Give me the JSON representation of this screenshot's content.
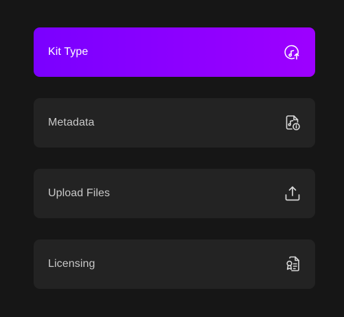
{
  "steps": [
    {
      "label": "Kit Type",
      "icon": "music-disc-upload-icon",
      "active": true
    },
    {
      "label": "Metadata",
      "icon": "music-file-info-icon",
      "active": false
    },
    {
      "label": "Upload Files",
      "icon": "upload-icon",
      "active": false
    },
    {
      "label": "Licensing",
      "icon": "license-document-icon",
      "active": false
    }
  ],
  "colors": {
    "background": "#161616",
    "card": "#232323",
    "active_start": "#7a00ff",
    "active_end": "#9d00ff",
    "label": "#c9c9c9",
    "active_label": "#ffffff"
  }
}
